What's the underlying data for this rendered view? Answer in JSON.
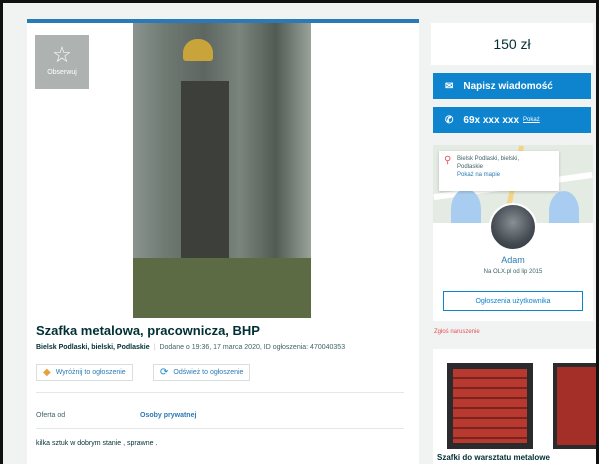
{
  "listing": {
    "favorite_label": "Obserwuj",
    "title": "Szafka metalowa, pracownicza, BHP",
    "location": "Bielsk Podlaski, bielski, Podlaskie",
    "added": "Dodane o 19:36, 17 marca 2020, ID ogłoszenia: 470040353",
    "promote_label": "Wyróżnij to ogłoszenie",
    "refresh_label": "Odśwież to ogłoszenie",
    "offer_from_label": "Oferta od",
    "offer_from_value": "Osoby prywatnej",
    "description": "kilka sztuk w dobrym stanie , sprawne ."
  },
  "sidebar": {
    "price": "150 zł",
    "message_button": "Napisz wiadomość",
    "phone_number": "69x xxx xxx",
    "phone_show": "Pokaż",
    "map_location_line1": "Bielsk Podlaski, bielski,",
    "map_location_line2": "Podlaskie",
    "map_link": "Pokaż na mapie",
    "seller_name": "Adam",
    "seller_since": "Na OLX.pl od lip 2015",
    "seller_ads_button": "Ogłoszenia użytkownika",
    "report_link": "Zgłoś naruszenie",
    "promo_title": "Szafki do warsztatu metalowe"
  }
}
